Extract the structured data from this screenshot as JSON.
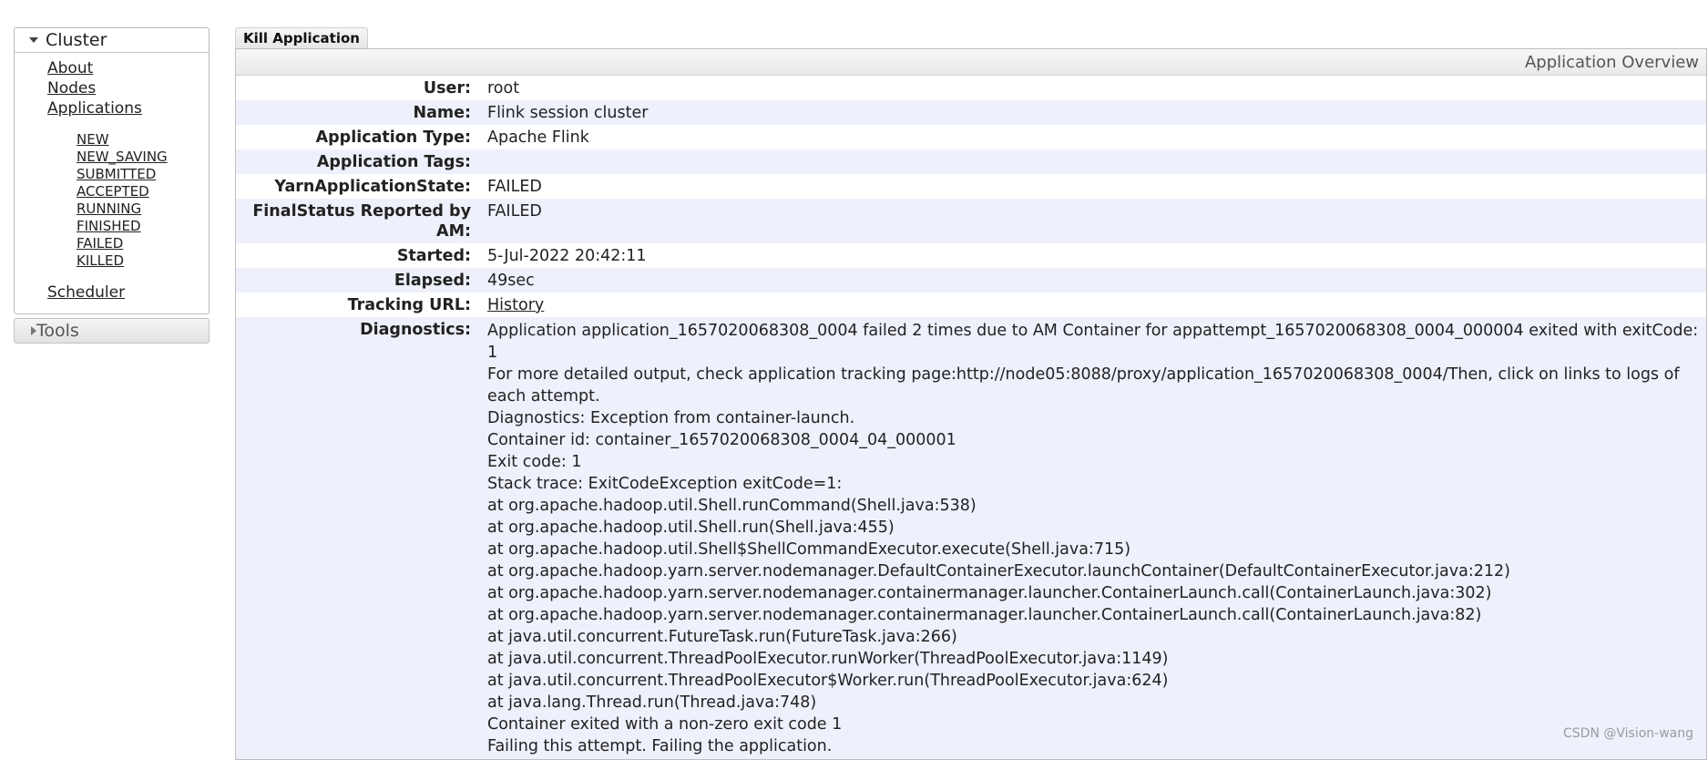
{
  "sidebar": {
    "cluster": {
      "label": "Cluster",
      "links": {
        "about": "About",
        "nodes": "Nodes",
        "applications": "Applications",
        "scheduler": "Scheduler"
      },
      "states": [
        "NEW",
        "NEW_SAVING",
        "SUBMITTED",
        "ACCEPTED",
        "RUNNING",
        "FINISHED",
        "FAILED",
        "KILLED"
      ]
    },
    "tools": {
      "label": "Tools"
    }
  },
  "main": {
    "kill_button": "Kill Application",
    "overview_title": "Application Overview",
    "fields": {
      "user": {
        "label": "User:",
        "value": "root"
      },
      "name": {
        "label": "Name:",
        "value": "Flink session cluster"
      },
      "app_type": {
        "label": "Application Type:",
        "value": "Apache Flink"
      },
      "app_tags": {
        "label": "Application Tags:",
        "value": ""
      },
      "yarn_state": {
        "label": "YarnApplicationState:",
        "value": "FAILED"
      },
      "final_status": {
        "label": "FinalStatus Reported by AM:",
        "value": "FAILED"
      },
      "started": {
        "label": "Started:",
        "value": "5-Jul-2022 20:42:11"
      },
      "elapsed": {
        "label": "Elapsed:",
        "value": "49sec"
      },
      "tracking_url": {
        "label": "Tracking URL:",
        "value": "History"
      },
      "diagnostics": {
        "label": "Diagnostics:",
        "lines": [
          "Application application_1657020068308_0004 failed 2 times due to AM Container for appattempt_1657020068308_0004_000004 exited with exitCode: 1",
          "For more detailed output, check application tracking page:http://node05:8088/proxy/application_1657020068308_0004/Then, click on links to logs of each attempt.",
          "Diagnostics: Exception from container-launch.",
          "Container id: container_1657020068308_0004_04_000001",
          "Exit code: 1",
          "Stack trace: ExitCodeException exitCode=1:",
          "at org.apache.hadoop.util.Shell.runCommand(Shell.java:538)",
          "at org.apache.hadoop.util.Shell.run(Shell.java:455)",
          "at org.apache.hadoop.util.Shell$ShellCommandExecutor.execute(Shell.java:715)",
          "at org.apache.hadoop.yarn.server.nodemanager.DefaultContainerExecutor.launchContainer(DefaultContainerExecutor.java:212)",
          "at org.apache.hadoop.yarn.server.nodemanager.containermanager.launcher.ContainerLaunch.call(ContainerLaunch.java:302)",
          "at org.apache.hadoop.yarn.server.nodemanager.containermanager.launcher.ContainerLaunch.call(ContainerLaunch.java:82)",
          "at java.util.concurrent.FutureTask.run(FutureTask.java:266)",
          "at java.util.concurrent.ThreadPoolExecutor.runWorker(ThreadPoolExecutor.java:1149)",
          "at java.util.concurrent.ThreadPoolExecutor$Worker.run(ThreadPoolExecutor.java:624)",
          "at java.lang.Thread.run(Thread.java:748)",
          "Container exited with a non-zero exit code 1",
          "Failing this attempt. Failing the application."
        ]
      }
    }
  },
  "watermark": "CSDN @Vision-wang"
}
